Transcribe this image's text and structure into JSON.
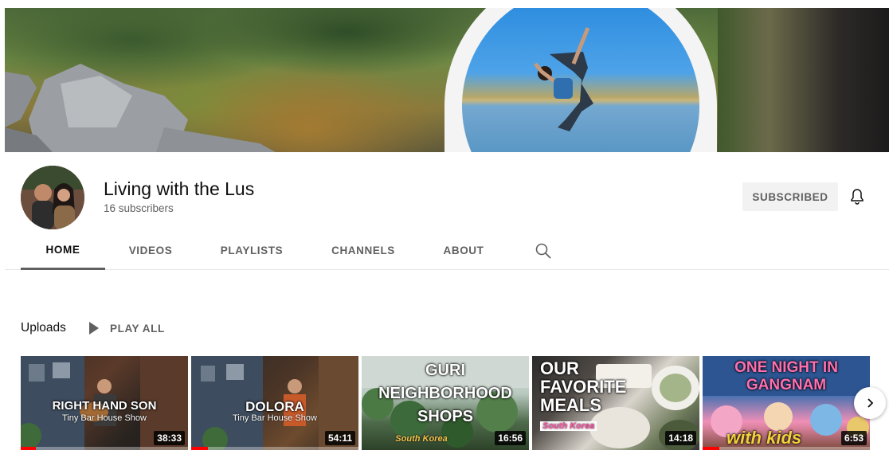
{
  "channel": {
    "name": "Living with the Lus",
    "subscribers": "16 subscribers",
    "subscribe_label": "SUBSCRIBED"
  },
  "tabs": [
    {
      "label": "HOME",
      "active": true
    },
    {
      "label": "VIDEOS",
      "active": false
    },
    {
      "label": "PLAYLISTS",
      "active": false
    },
    {
      "label": "CHANNELS",
      "active": false
    },
    {
      "label": "ABOUT",
      "active": false
    }
  ],
  "uploads": {
    "title": "Uploads",
    "play_all_label": "PLAY ALL",
    "videos": [
      {
        "thumb_title": "RIGHT HAND SON",
        "thumb_subtitle": "Tiny Bar House Show",
        "duration": "38:33",
        "watched_fraction": 0.09
      },
      {
        "thumb_title": "DOLORA",
        "thumb_subtitle": "Tiny Bar House Show",
        "duration": "54:11",
        "watched_fraction": 0.1
      },
      {
        "thumb_title": "GURI NEIGHBORHOOD SHOPS",
        "thumb_subtitle": "South Korea",
        "duration": "16:56",
        "watched_fraction": 0
      },
      {
        "thumb_title": "OUR FAVORITE MEALS",
        "thumb_subtitle": "South Korea",
        "duration": "14:18",
        "watched_fraction": 0
      },
      {
        "thumb_title": "ONE NIGHT IN GANGNAM",
        "thumb_subtitle": "with kids",
        "duration": "6:53",
        "watched_fraction": 0.1
      }
    ]
  },
  "colors": {
    "accent_red": "#ff0000",
    "muted_text": "#606060",
    "button_bg": "#f2f2f2"
  },
  "icons": {
    "bell": "bell-icon",
    "search": "search-icon",
    "play": "play-icon",
    "next": "chevron-right-icon"
  }
}
